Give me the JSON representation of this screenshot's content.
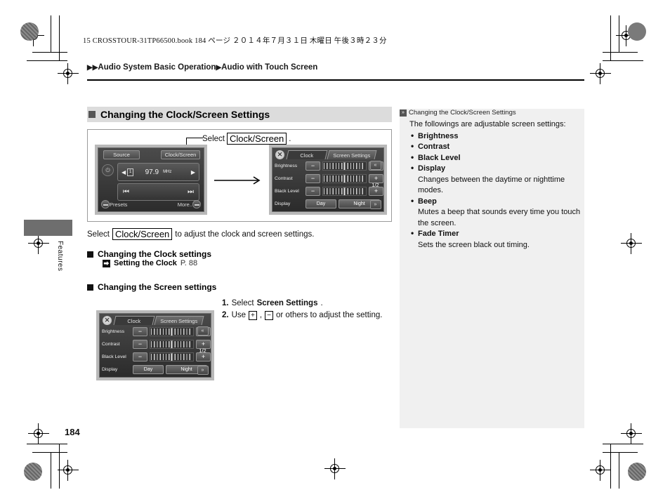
{
  "print": {
    "book_line": "15 CROSSTOUR-31TP66500.book   184 ページ   ２０１４年７月３１日   木曜日   午後３時２３分"
  },
  "breadcrumb": {
    "marker": "▶▶",
    "part1": "Audio System Basic Operation",
    "sep": "▶",
    "part2": "Audio with Touch Screen"
  },
  "section": {
    "heading": "Changing the Clock/Screen Settings"
  },
  "illustration": {
    "callout_prefix": "Select",
    "callout_key": "Clock/Screen",
    "callout_suffix": "."
  },
  "radio_screen": {
    "source_label": "Source",
    "clock_screen_label": "Clock/Screen",
    "preset_number": "1",
    "frequency": "97.9",
    "frequency_unit": "MHz",
    "left_arrow": "◀",
    "right_arrow": "▶",
    "seek_prev": "⏮",
    "seek_next": "⏭",
    "presets_label": "Presets",
    "more_label": "More..",
    "power_icon": "⏻"
  },
  "settings_screen": {
    "close_label": "✕",
    "tab_clock": "Clock",
    "tab_screen": "Screen Settings",
    "rows": [
      {
        "label": "Brightness",
        "minus": "−",
        "plus": "+"
      },
      {
        "label": "Contrast",
        "minus": "−",
        "plus": "+"
      },
      {
        "label": "Black Level",
        "minus": "−",
        "plus": "+"
      }
    ],
    "display_label": "Display",
    "day_label": "Day",
    "night_label": "Night",
    "scroll_up": "«",
    "scroll_down": "»",
    "page_indicator": "1/2"
  },
  "body": {
    "select_prefix": "Select",
    "select_key": "Clock/Screen",
    "select_suffix": "to adjust the clock and screen settings.",
    "clock_settings_heading": "Changing the Clock settings",
    "xref_icon": "⮕",
    "xref_title": "Setting the Clock",
    "xref_page": "P. 88",
    "screen_settings_heading": "Changing the Screen settings"
  },
  "steps": [
    {
      "num": "1.",
      "pre": "Select",
      "bold": "Screen Settings",
      "post": "."
    },
    {
      "num": "2.",
      "pre": "Use",
      "key1": "+",
      "mid": ",",
      "key2": "−",
      "post": "or others to adjust the setting."
    }
  ],
  "sidebar": {
    "mark": "»",
    "title": "Changing the Clock/Screen Settings",
    "intro": "The followings are adjustable screen settings:",
    "items": [
      {
        "label": "Brightness",
        "desc": ""
      },
      {
        "label": "Contrast",
        "desc": ""
      },
      {
        "label": "Black Level",
        "desc": ""
      },
      {
        "label": "Display",
        "desc": "Changes between the daytime or nighttime modes."
      },
      {
        "label": "Beep",
        "desc": "Mutes a beep that sounds every time you touch the screen."
      },
      {
        "label": "Fade Timer",
        "desc": "Sets the screen black out timing."
      }
    ]
  },
  "left_tab": {
    "label": "Features"
  },
  "footer": {
    "page_number": "184"
  }
}
